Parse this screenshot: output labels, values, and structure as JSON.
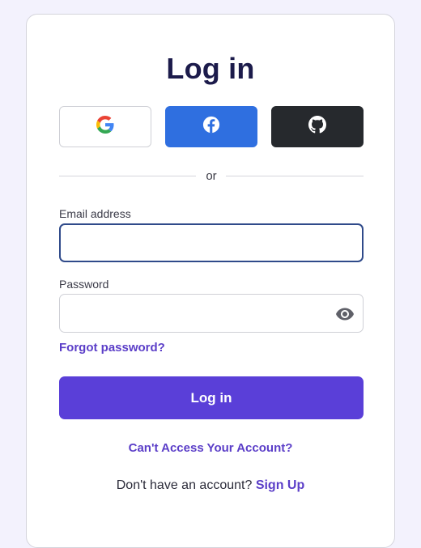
{
  "page": {
    "title": "Log in"
  },
  "social": {
    "google": {
      "icon": "google-icon",
      "color": "#ffffff"
    },
    "facebook": {
      "icon": "facebook-icon",
      "color": "#2f6fe0"
    },
    "github": {
      "icon": "github-icon",
      "color": "#26292d"
    }
  },
  "divider": {
    "text": "or"
  },
  "form": {
    "email": {
      "label": "Email address",
      "value": "",
      "placeholder": ""
    },
    "password": {
      "label": "Password",
      "value": "",
      "placeholder": "",
      "toggle_icon": "eye-icon"
    },
    "forgot_password": "Forgot password?",
    "submit_label": "Log in"
  },
  "footer": {
    "cant_access": "Can't Access Your Account?",
    "no_account_text": "Don't have an account?",
    "signup_link": "Sign Up"
  },
  "colors": {
    "background": "#f3f2fd",
    "primary": "#5a3fd8",
    "link": "#5b3ec8",
    "title": "#1c1b4b"
  }
}
